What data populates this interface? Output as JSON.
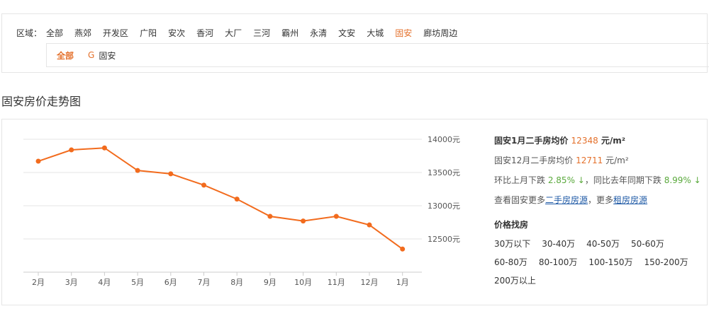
{
  "filter": {
    "label": "区域：",
    "areas": [
      "全部",
      "燕郊",
      "开发区",
      "广阳",
      "安次",
      "香河",
      "大厂",
      "三河",
      "霸州",
      "永清",
      "文安",
      "大城",
      "固安",
      "廊坊周边"
    ],
    "active_index": 12,
    "sub_all": "全部",
    "sub_letter": "G",
    "sub_item": "固安"
  },
  "section_title": "固安房价走势图",
  "chart_data": {
    "type": "line",
    "categories": [
      "2月",
      "3月",
      "4月",
      "5月",
      "6月",
      "7月",
      "8月",
      "9月",
      "10月",
      "11月",
      "12月",
      "1月"
    ],
    "series": [
      {
        "values": [
          13670,
          13840,
          13870,
          13530,
          13480,
          13310,
          13100,
          12840,
          12770,
          12840,
          12711,
          12348
        ],
        "color": "#f26b1d"
      }
    ],
    "ytick_labels": [
      "14000元",
      "13500元",
      "13000元",
      "12500元"
    ],
    "ylim": [
      12000,
      14000
    ],
    "yticks": [
      14000,
      13500,
      13000,
      12500
    ],
    "ylabel_position": "right",
    "grid": true
  },
  "info": {
    "head_prefix": "固安1月二手房均价",
    "head_value": "12348",
    "head_unit": "元/m²",
    "prev_prefix": "固安12月二手房均价",
    "prev_value": "12711",
    "prev_unit": "元/m²",
    "mom_prefix": "环比上月下跌",
    "mom_value": "2.85% ↓",
    "yoy_prefix": "，同比去年同期下跌",
    "yoy_value": "8.99% ↓",
    "more_prefix": "查看固安更多",
    "more_link1": "二手房房源",
    "more_mid": "，更多",
    "more_link2": "租房房源",
    "price_title": "价格找房",
    "price_ranges": [
      "30万以下",
      "30-40万",
      "40-50万",
      "50-60万",
      "60-80万",
      "80-100万",
      "100-150万",
      "150-200万",
      "200万以上"
    ]
  }
}
